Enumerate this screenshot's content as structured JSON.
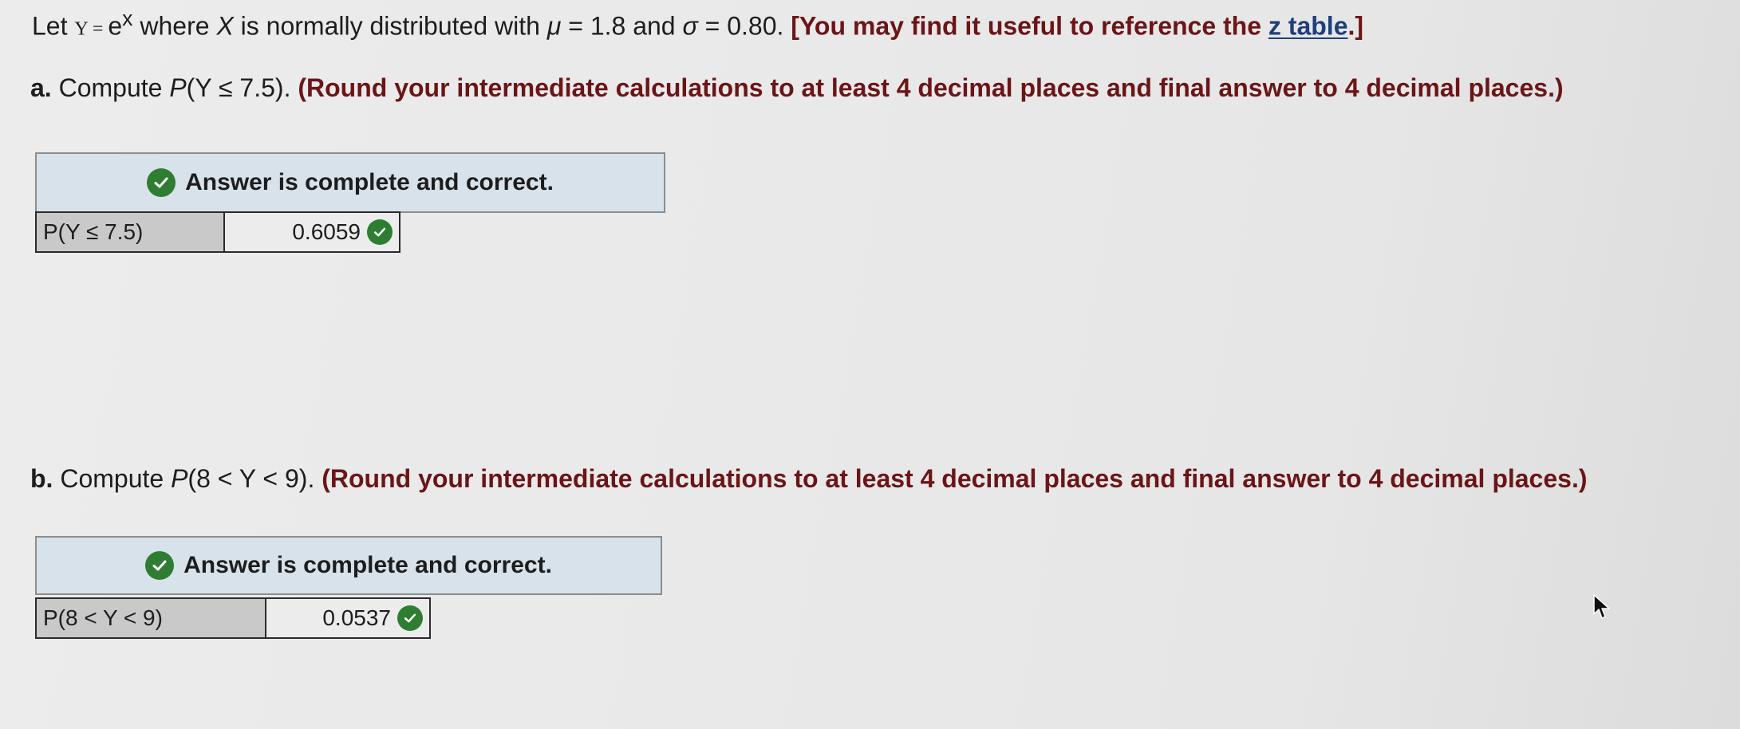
{
  "intro": {
    "let": "Let",
    "y_var": "Y",
    "equals": " = ",
    "e": "e",
    "x_sup": "x",
    "text1": " where ",
    "x_var": "X",
    "text2": " is normally distributed with ",
    "mu": "μ",
    "mu_val": " = 1.8 and ",
    "sigma": "σ",
    "sigma_val": " = 0.80. ",
    "hint": "[You may find it useful to reference the ",
    "link": "z table",
    "hint_end": ".]"
  },
  "part_a": {
    "letter": "a.",
    "compute": " Compute ",
    "expr_p": "P",
    "expr": "(Y ≤ 7.5). ",
    "instruction": "(Round your intermediate calculations to at least 4 decimal places and final answer to 4 decimal places.)",
    "banner": "Answer is complete and correct.",
    "row_label": "P(Y ≤ 7.5)",
    "value": "0.6059"
  },
  "part_b": {
    "letter": "b.",
    "compute": " Compute ",
    "expr_p": "P",
    "expr": "(8 < Y < 9). ",
    "instruction": "(Round your intermediate calculations to at least 4 decimal places and final answer to 4 decimal places.)",
    "banner": "Answer is complete and correct.",
    "row_label": "P(8 < Y < 9)",
    "value": "0.0537"
  },
  "colors": {
    "check": "#2f7d32",
    "maroon": "#6b1518",
    "banner_bg": "#d7e2ea",
    "link": "#1f3f7a"
  },
  "icons": {
    "check": "checkmark-circle-icon",
    "cursor": "mouse-pointer-icon"
  }
}
